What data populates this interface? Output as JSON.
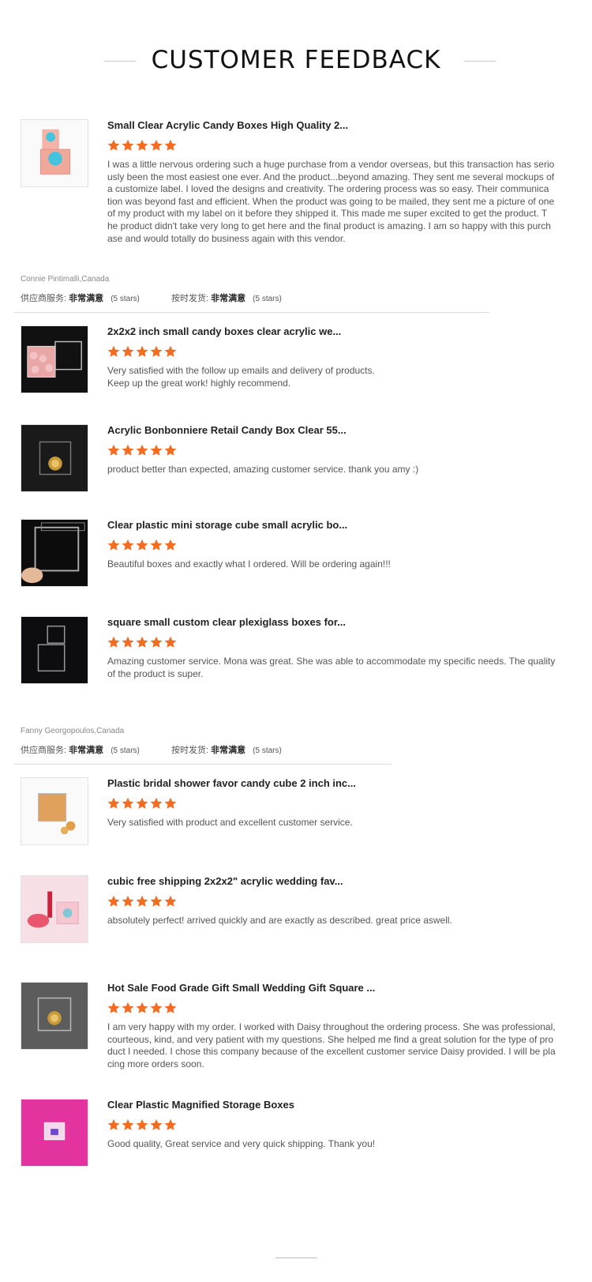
{
  "header": {
    "title": "CUSTOMER FEEDBACK"
  },
  "star_color": "#f26d21",
  "reviews": [
    {
      "product": "Small Clear Acrylic Candy Boxes High Quality 2...",
      "rating": 5,
      "comment": "I was a little nervous ordering such a huge purchase from a vendor overseas, but this transaction has serio\nusly been the most easiest one ever.  And the product...beyond amazing.  They sent me several mockups of\na customize label.  I loved the designs and creativity.  The ordering process was so easy.  Their communica\ntion was beyond fast and efficient.  When the product was going to be mailed, they sent me a picture of one\nof my product with my label on it before they shipped it.  This made me super excited to get the product.  T\nhe product didn't take very long to get here and the final product is amazing.  I am so happy with this purch\nase and would totally do business again with this vendor.",
      "image": "pink-candy-cube"
    },
    {
      "product": "2x2x2 inch small candy boxes clear acrylic we...",
      "rating": 5,
      "comment": "Very satisfied with the follow up emails and delivery of products.\nKeep up the great work! highly recommend.",
      "image": "candy-filled-cubes"
    },
    {
      "product": "Acrylic Bonbonniere Retail Candy Box Clear 55...",
      "rating": 5,
      "comment": "product better than expected, amazing customer service. thank you amy :)",
      "image": "chocolate-cube-dark"
    },
    {
      "product": "Clear plastic mini storage cube small acrylic bo...",
      "rating": 5,
      "comment": "Beautiful boxes and exactly what I ordered. Will be ordering again!!!",
      "image": "hand-holding-cube"
    },
    {
      "product": "square small custom clear plexiglass boxes for...",
      "rating": 5,
      "comment": "Amazing customer service. Mona was great. She was able to accommodate my specific needs. The quality\nof the product is super.",
      "image": "stacked-cubes-dark"
    },
    {
      "product": "Plastic bridal shower favor candy cube 2 inch inc...",
      "rating": 5,
      "comment": "Very satisfied with product and excellent customer service.",
      "image": "gummy-bear-cube"
    },
    {
      "product": "cubic free shipping 2x2x2\" acrylic wedding fav...",
      "rating": 5,
      "comment": "absolutely perfect! arrived quickly and are exactly as described. great price aswell.",
      "image": "pink-cosmetic-scene"
    },
    {
      "product": "Hot Sale Food Grade Gift Small Wedding Gift Square ...",
      "rating": 5,
      "comment": "I am very happy with my order. I worked with Daisy throughout the ordering process. She was professional,\ncourteous, kind, and very patient with my questions. She helped me find a great solution for the type of pro\nduct I needed. I chose this company because of the excellent customer service Daisy provided. I will be pla\ncing more orders soon.",
      "image": "chocolate-cube-grey"
    },
    {
      "product": "Clear Plastic Magnified Storage Boxes",
      "rating": 5,
      "comment": "Good quality, Great service and very quick shipping. Thank you!",
      "image": "magenta-box"
    }
  ],
  "reviewers": [
    {
      "name": "Connie Pintimalli,Canada",
      "supplier_label": "供应商服务:",
      "supplier_value": "非常满意",
      "supplier_stars": "(5 stars)",
      "ontime_label": "按时发货:",
      "ontime_value": "非常满意",
      "ontime_stars": "(5 stars)"
    },
    {
      "name": "Fanny Georgopoulos,Canada",
      "supplier_label": "供应商服务:",
      "supplier_value": "非常满意",
      "supplier_stars": "(5 stars)",
      "ontime_label": "按时发货:",
      "ontime_value": "非常满意",
      "ontime_stars": "(5 stars)"
    }
  ]
}
